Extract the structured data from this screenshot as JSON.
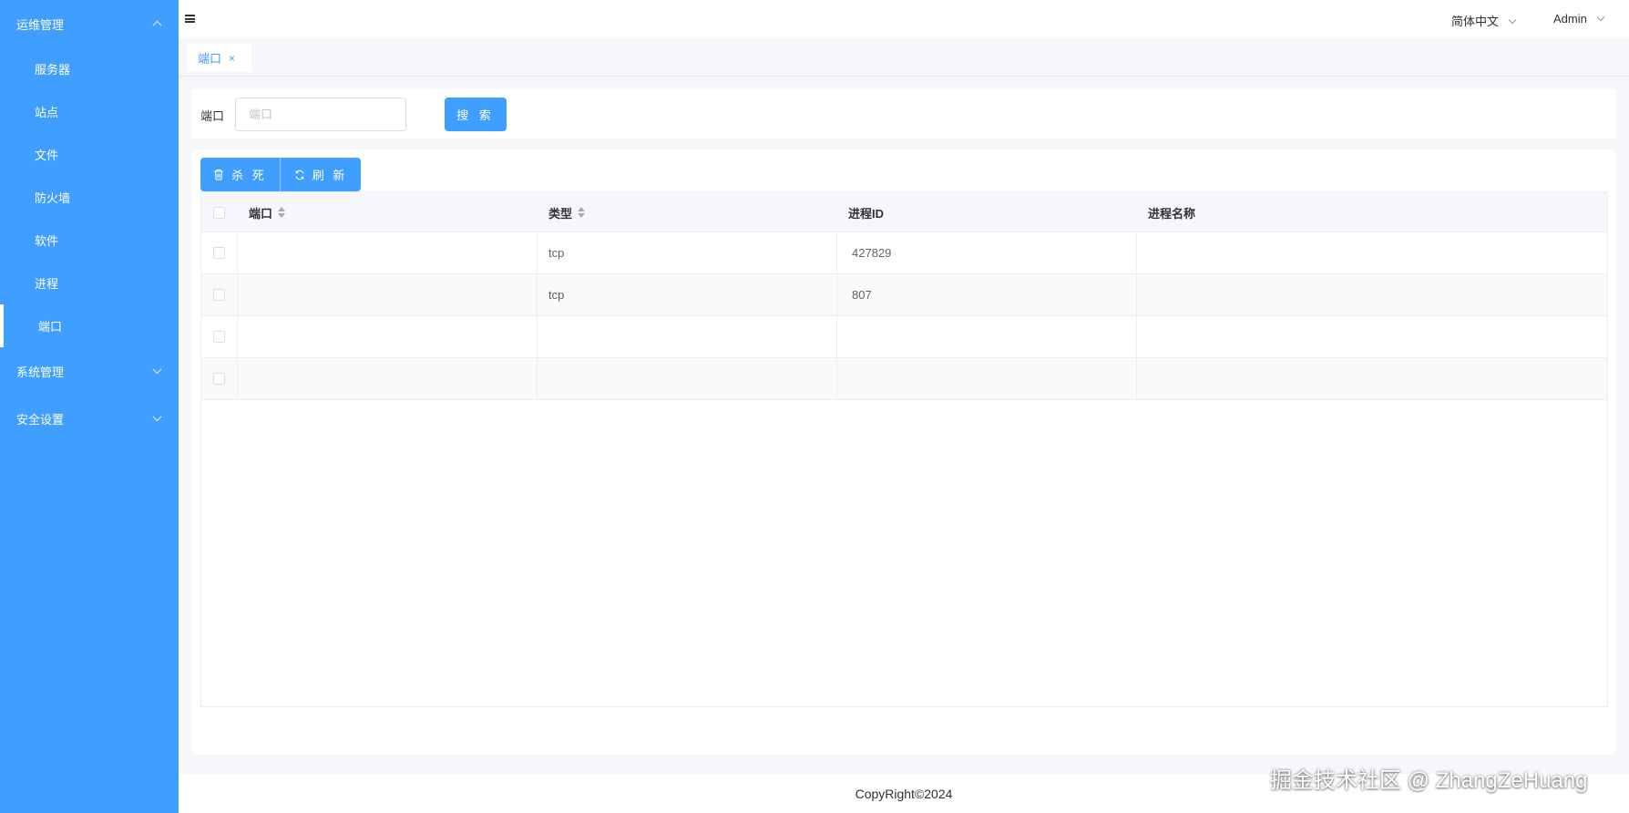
{
  "sidebar": {
    "groups": [
      {
        "label": "运维管理",
        "expanded": true,
        "items": [
          {
            "label": "服务器"
          },
          {
            "label": "站点"
          },
          {
            "label": "文件"
          },
          {
            "label": "防火墙"
          },
          {
            "label": "软件"
          },
          {
            "label": "进程"
          },
          {
            "label": "端口",
            "active": true
          }
        ]
      },
      {
        "label": "系统管理",
        "expanded": false
      },
      {
        "label": "安全设置",
        "expanded": false
      }
    ]
  },
  "header": {
    "language": "简体中文",
    "user": "Admin"
  },
  "tabs": [
    {
      "label": "端口",
      "close": "×"
    }
  ],
  "search": {
    "label": "端口",
    "placeholder": "端口",
    "value": "",
    "button": "搜 索"
  },
  "toolbar": {
    "kill": "杀 死",
    "refresh": "刷 新"
  },
  "table": {
    "columns": [
      {
        "label": "端口",
        "sortable": true
      },
      {
        "label": "类型",
        "sortable": true
      },
      {
        "label": "进程ID",
        "sortable": false
      },
      {
        "label": "进程名称",
        "sortable": false
      }
    ],
    "rows": [
      {
        "port": "",
        "type": "tcp",
        "pid": "427829",
        "name": ""
      },
      {
        "port": "",
        "type": "tcp",
        "pid": "807",
        "name": ""
      },
      {
        "port": "",
        "type": "",
        "pid": "",
        "name": ""
      },
      {
        "port": "",
        "type": "",
        "pid": "",
        "name": ""
      }
    ]
  },
  "footer": {
    "copyright": "CopyRight©2024"
  },
  "watermark": "掘金技术社区 @ ZhangZeHuang",
  "colors": {
    "primary": "#409eff",
    "background": "#f5f7fa",
    "border": "#ebeef5"
  }
}
